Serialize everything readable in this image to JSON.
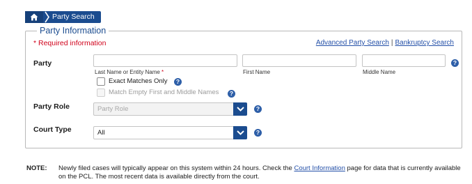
{
  "breadcrumb": {
    "home_icon": "home-icon",
    "current": "Party Search"
  },
  "section": {
    "legend": "Party Information",
    "required_text": "* Required information"
  },
  "links": {
    "advanced": "Advanced Party Search",
    "separator": "|",
    "bankruptcy": "Bankruptcy Search"
  },
  "party": {
    "label": "Party",
    "last_name": {
      "value": "",
      "sublabel": "Last Name or Entity Name",
      "required_mark": "*"
    },
    "first_name": {
      "value": "",
      "sublabel": "First Name"
    },
    "middle_name": {
      "value": "",
      "sublabel": "Middle Name"
    },
    "exact_matches": {
      "label": "Exact Matches Only",
      "checked": false
    },
    "match_empty": {
      "label": "Match Empty First and Middle Names",
      "checked": false,
      "disabled": true
    }
  },
  "party_role": {
    "label": "Party Role",
    "placeholder": "Party Role"
  },
  "court_type": {
    "label": "Court Type",
    "selected": "All"
  },
  "note": {
    "label": "NOTE:",
    "text_before": "Newly filed cases will typically appear on this system within 24 hours. Check the",
    "link": "Court Information",
    "text_after": "page for data that is currently available on the PCL. The most recent data is available directly from the court."
  },
  "colors": {
    "brand": "#1b4c8f",
    "required": "#d0021b",
    "link": "#2450a8"
  }
}
